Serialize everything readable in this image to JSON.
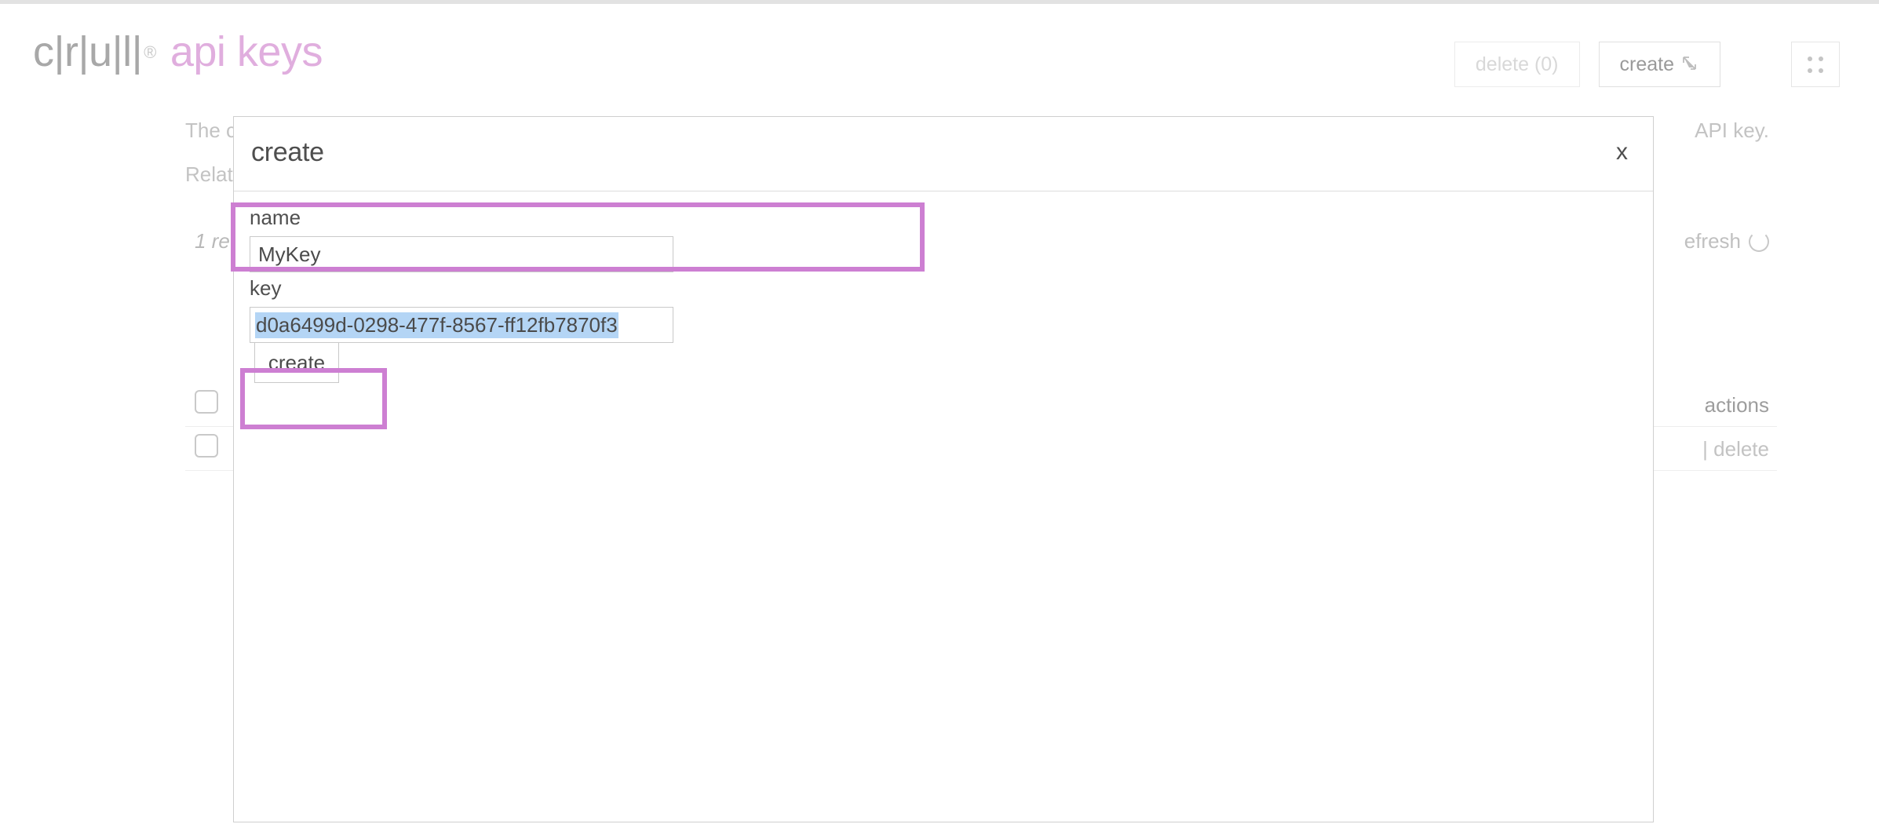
{
  "header": {
    "logo_mark": "c|r|u|l|",
    "logo_registered": "®",
    "title": "api keys",
    "delete_button": "delete (0)",
    "create_button": "create",
    "create_button_icon": "cursor-arrow-icon",
    "grid_button_icon": "grid-dots-icon"
  },
  "background": {
    "description_line1": "The c",
    "description_line1_tail": "API key.",
    "description_line2": "Relat",
    "result_count": "1 re",
    "refresh_label": "efresh",
    "refresh_icon": "refresh-icon",
    "table_header_actions": "actions",
    "row_actions": "| delete"
  },
  "modal": {
    "title": "create",
    "close_label": "x",
    "name": {
      "label": "name",
      "value": "MyKey",
      "placeholder": ""
    },
    "key": {
      "label": "key",
      "value": "d0a6499d-0298-477f-8567-ff12fb7870f3",
      "selected": true
    },
    "submit_label": "create"
  },
  "colors": {
    "brand_pink": "#e0aede",
    "highlight_pink": "#cd7fd2",
    "selection_blue": "#b4d5f5",
    "border_grey": "#c9c9c9",
    "text_grey": "#4a4a4a",
    "muted_grey": "#c3c3c3"
  }
}
